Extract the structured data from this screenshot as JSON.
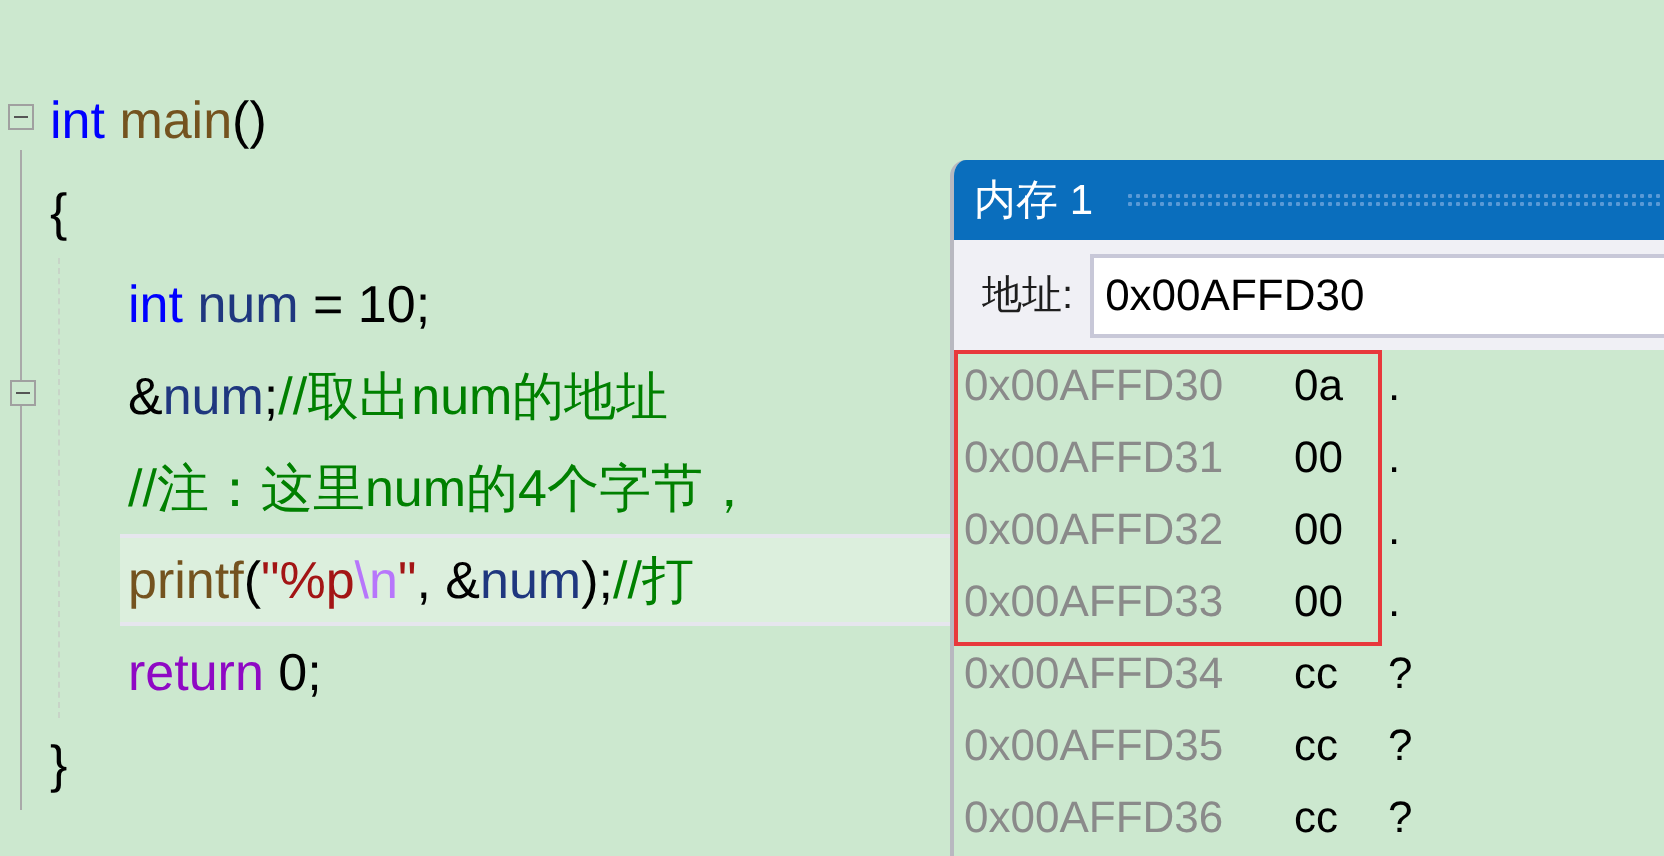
{
  "code": {
    "header": {
      "fold": true,
      "highlighted": false,
      "tokens": [
        {
          "kind": "keyword",
          "text": "int"
        },
        {
          "kind": "func",
          "text": " main"
        },
        {
          "kind": "plain",
          "text": "()"
        }
      ]
    },
    "open": {
      "fold": false,
      "highlighted": false,
      "tokens": [
        {
          "kind": "plain",
          "text": "{"
        }
      ]
    },
    "body": [
      {
        "fold": false,
        "highlighted": false,
        "tokens": [
          {
            "kind": "keyword",
            "text": "int"
          },
          {
            "kind": "var",
            "text": " num"
          },
          {
            "kind": "plain",
            "text": " = 10;"
          }
        ]
      },
      {
        "fold": true,
        "highlighted": false,
        "tokens": [
          {
            "kind": "plain",
            "text": "&"
          },
          {
            "kind": "var",
            "text": "num"
          },
          {
            "kind": "plain",
            "text": ";"
          },
          {
            "kind": "comment",
            "text": "//取出num的地址"
          }
        ]
      },
      {
        "fold": false,
        "highlighted": false,
        "tokens": [
          {
            "kind": "comment",
            "text": "//注：这里num的4个字节，"
          }
        ]
      },
      {
        "fold": false,
        "highlighted": true,
        "tokens": [
          {
            "kind": "func",
            "text": "printf"
          },
          {
            "kind": "plain",
            "text": "("
          },
          {
            "kind": "string",
            "text": "\"%p"
          },
          {
            "kind": "escape",
            "text": "\\n"
          },
          {
            "kind": "string",
            "text": "\""
          },
          {
            "kind": "plain",
            "text": ", &"
          },
          {
            "kind": "var",
            "text": "num"
          },
          {
            "kind": "plain",
            "text": ");"
          },
          {
            "kind": "comment",
            "text": "//打"
          }
        ]
      },
      {
        "fold": false,
        "highlighted": false,
        "tokens": [
          {
            "kind": "control",
            "text": "return"
          },
          {
            "kind": "plain",
            "text": " 0;"
          }
        ]
      }
    ],
    "close": {
      "fold": false,
      "highlighted": false,
      "tokens": [
        {
          "kind": "plain",
          "text": "}"
        }
      ]
    }
  },
  "memory_window": {
    "title": "内存 1",
    "address_label": "地址:",
    "address_value": "0x00AFFD30",
    "rows": [
      {
        "address": "0x00AFFD30",
        "byte": "0a",
        "char": ".",
        "marked": true
      },
      {
        "address": "0x00AFFD31",
        "byte": "00",
        "char": ".",
        "marked": true
      },
      {
        "address": "0x00AFFD32",
        "byte": "00",
        "char": ".",
        "marked": true
      },
      {
        "address": "0x00AFFD33",
        "byte": "00",
        "char": ".",
        "marked": true
      },
      {
        "address": "0x00AFFD34",
        "byte": "cc",
        "char": "?",
        "marked": false
      },
      {
        "address": "0x00AFFD35",
        "byte": "cc",
        "char": "?",
        "marked": false
      },
      {
        "address": "0x00AFFD36",
        "byte": "cc",
        "char": "?",
        "marked": false
      }
    ]
  }
}
